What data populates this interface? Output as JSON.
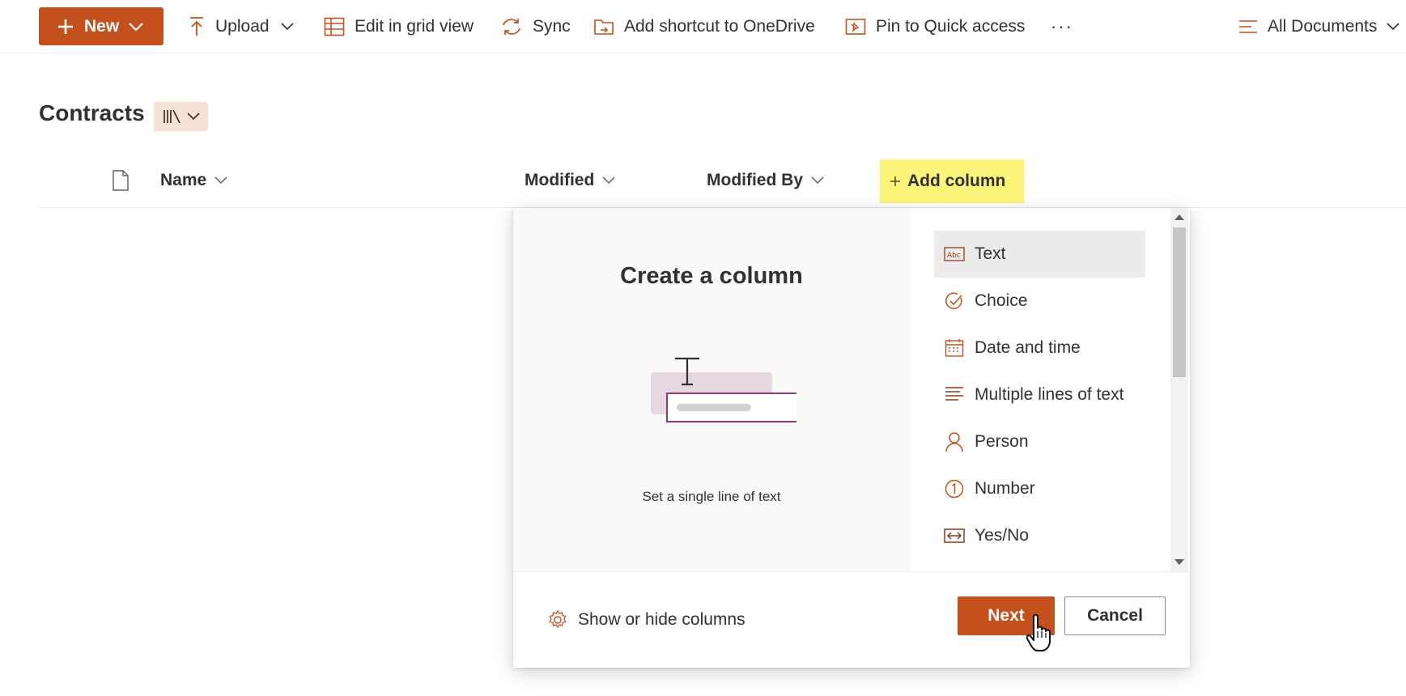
{
  "command_bar": {
    "new_label": "New",
    "upload_label": "Upload",
    "grid_label": "Edit in grid view",
    "sync_label": "Sync",
    "shortcut_label": "Add shortcut to OneDrive",
    "pin_label": "Pin to Quick access",
    "more_label": "···",
    "view_label": "All Documents"
  },
  "library": {
    "title": "Contracts"
  },
  "columns": {
    "name": "Name",
    "modified": "Modified",
    "modified_by": "Modified By",
    "add_column": "Add column"
  },
  "panel": {
    "title": "Create a column",
    "description": "Set a single line of text",
    "types": [
      {
        "label": "Text",
        "icon": "text-abc-icon",
        "selected": true
      },
      {
        "label": "Choice",
        "icon": "choice-check-icon"
      },
      {
        "label": "Date and time",
        "icon": "calendar-icon"
      },
      {
        "label": "Multiple lines of text",
        "icon": "multiline-text-icon"
      },
      {
        "label": "Person",
        "icon": "person-icon"
      },
      {
        "label": "Number",
        "icon": "number-icon"
      },
      {
        "label": "Yes/No",
        "icon": "yes-no-icon"
      }
    ],
    "show_hide_label": "Show or hide columns",
    "next_label": "Next",
    "cancel_label": "Cancel"
  },
  "colors": {
    "accent": "#c4501e",
    "highlight": "#fbf67a",
    "selected_bg": "#edebe9"
  }
}
